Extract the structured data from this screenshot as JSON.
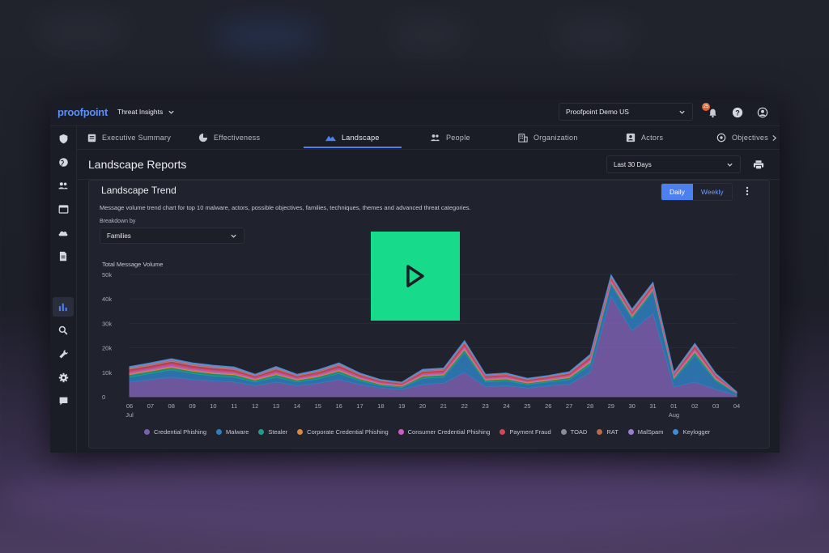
{
  "brand": "proofpoint",
  "product_selector": "Threat Insights",
  "account_selector": "Proofpoint Demo US",
  "notifications_count": "25",
  "tabs": [
    {
      "label": "Executive Summary",
      "icon": "report-icon"
    },
    {
      "label": "Effectiveness",
      "icon": "pie-icon"
    },
    {
      "label": "Landscape",
      "icon": "mountain-icon"
    },
    {
      "label": "People",
      "icon": "people-icon"
    },
    {
      "label": "Organization",
      "icon": "building-icon"
    },
    {
      "label": "Actors",
      "icon": "badge-icon"
    },
    {
      "label": "Objectives",
      "icon": "target-icon"
    }
  ],
  "active_tab": "Landscape",
  "page_title": "Landscape Reports",
  "date_range": "Last 30 Days",
  "card": {
    "title": "Landscape Trend",
    "toggle_daily": "Daily",
    "toggle_weekly": "Weekly",
    "description": "Message volume trend chart for top 10 malware, actors, possible objectives, families, techniques, themes and advanced threat categories.",
    "breakdown_label": "Breakdown by",
    "breakdown_value": "Families"
  },
  "colors": {
    "accent": "#4c7ff0",
    "play": "#17db8a",
    "credential_phishing": "#7b5fb0",
    "malware": "#2f7fbf"
  },
  "chart_data": {
    "type": "area",
    "ylabel": "Total Message Volume",
    "y_ticks": [
      "50k",
      "40k",
      "30k",
      "20k",
      "10k",
      "0"
    ],
    "ylim": [
      0,
      50000
    ],
    "categories": [
      "06",
      "07",
      "08",
      "09",
      "10",
      "11",
      "12",
      "13",
      "14",
      "15",
      "16",
      "17",
      "18",
      "19",
      "20",
      "21",
      "22",
      "23",
      "24",
      "25",
      "26",
      "27",
      "28",
      "29",
      "30",
      "31",
      "01",
      "02",
      "03",
      "04"
    ],
    "month_labels": [
      {
        "at": "06",
        "label": "Jul"
      },
      {
        "at": "01",
        "label": "Aug"
      }
    ],
    "stacked": true,
    "grid": true,
    "legend_position": "bottom",
    "series": [
      {
        "name": "Credential Phishing",
        "color": "#7b5fb0",
        "values": [
          6000,
          7000,
          8000,
          7000,
          6500,
          6000,
          4500,
          6000,
          4500,
          5500,
          7000,
          5000,
          3500,
          3000,
          5000,
          5500,
          10000,
          4000,
          4500,
          3500,
          4500,
          5000,
          10000,
          41000,
          27000,
          34000,
          4000,
          6000,
          3000,
          500
        ]
      },
      {
        "name": "Malware",
        "color": "#2f7fbf",
        "values": [
          2000,
          2500,
          3000,
          2500,
          2000,
          2000,
          1500,
          2000,
          1500,
          1800,
          2500,
          1500,
          1000,
          800,
          2500,
          2500,
          8000,
          2000,
          2000,
          1500,
          1500,
          2000,
          3000,
          5000,
          5000,
          9000,
          3000,
          11000,
          3500,
          800
        ]
      },
      {
        "name": "Stealer",
        "color": "#1e9e8a",
        "values": [
          1000,
          1000,
          1000,
          1000,
          1000,
          1000,
          800,
          1000,
          800,
          900,
          1000,
          800,
          600,
          500,
          900,
          900,
          1200,
          800,
          800,
          600,
          700,
          800,
          1000,
          800,
          800,
          800,
          700,
          1200,
          700,
          200
        ]
      },
      {
        "name": "Corporate Credential Phishing",
        "color": "#d98a3c",
        "values": [
          500,
          500,
          500,
          500,
          500,
          500,
          400,
          500,
          400,
          450,
          500,
          400,
          300,
          250,
          450,
          450,
          600,
          400,
          400,
          300,
          350,
          400,
          500,
          400,
          400,
          400,
          350,
          600,
          350,
          100
        ]
      },
      {
        "name": "Consumer Credential Phishing",
        "color": "#c95fc0",
        "values": [
          800,
          800,
          900,
          800,
          800,
          700,
          600,
          800,
          600,
          700,
          800,
          600,
          500,
          400,
          700,
          700,
          900,
          600,
          600,
          500,
          500,
          600,
          800,
          700,
          700,
          700,
          600,
          900,
          600,
          100
        ]
      },
      {
        "name": "Payment Fraud",
        "color": "#d2465a",
        "values": [
          1000,
          1000,
          1100,
          1000,
          1000,
          900,
          700,
          1000,
          700,
          800,
          1000,
          700,
          600,
          500,
          800,
          800,
          1200,
          700,
          700,
          600,
          600,
          700,
          1000,
          900,
          900,
          900,
          700,
          1100,
          700,
          150
        ]
      },
      {
        "name": "TOAD",
        "color": "#8a8d99",
        "values": [
          300,
          300,
          300,
          300,
          300,
          300,
          200,
          300,
          200,
          250,
          300,
          200,
          150,
          150,
          250,
          250,
          300,
          200,
          200,
          150,
          150,
          200,
          300,
          300,
          300,
          300,
          200,
          300,
          200,
          50
        ]
      },
      {
        "name": "RAT",
        "color": "#b86a4a",
        "values": [
          300,
          300,
          300,
          300,
          300,
          300,
          200,
          300,
          200,
          250,
          300,
          200,
          150,
          150,
          250,
          250,
          300,
          200,
          200,
          150,
          150,
          200,
          300,
          300,
          300,
          300,
          200,
          300,
          200,
          50
        ]
      },
      {
        "name": "MalSpam",
        "color": "#9a7fd0",
        "values": [
          300,
          300,
          300,
          300,
          300,
          300,
          200,
          300,
          200,
          250,
          300,
          200,
          150,
          150,
          250,
          250,
          300,
          200,
          200,
          150,
          150,
          200,
          300,
          300,
          300,
          300,
          200,
          300,
          200,
          50
        ]
      },
      {
        "name": "Keylogger",
        "color": "#3a8fd8",
        "values": [
          200,
          200,
          200,
          200,
          200,
          200,
          150,
          200,
          150,
          150,
          200,
          150,
          100,
          100,
          150,
          150,
          200,
          150,
          150,
          100,
          100,
          150,
          200,
          200,
          200,
          200,
          150,
          200,
          150,
          50
        ]
      }
    ]
  }
}
